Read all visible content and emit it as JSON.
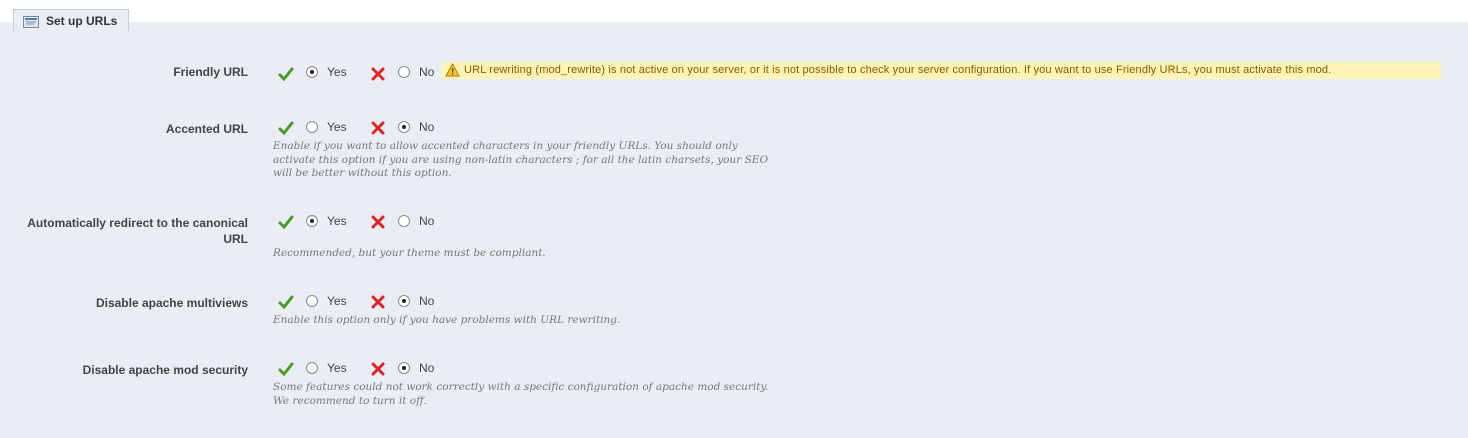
{
  "section": {
    "title": "Set up URLs",
    "icon": "settings-panel-icon"
  },
  "rows": [
    {
      "label": "Friendly URL",
      "yes_label": "Yes",
      "no_label": "No",
      "selected": "yes"
    },
    {
      "label": "Accented URL",
      "yes_label": "Yes",
      "no_label": "No",
      "selected": "no",
      "hint": "Enable if you want to allow accented characters in your friendly URLs. You should only activate this option if you are using non-latin characters ; for all the latin charsets, your SEO will be better without this option."
    },
    {
      "label": "Automatically redirect to the canonical URL",
      "yes_label": "Yes",
      "no_label": "No",
      "selected": "yes",
      "hint": "Recommended, but your theme must be compliant."
    },
    {
      "label": "Disable apache multiviews",
      "yes_label": "Yes",
      "no_label": "No",
      "selected": "no",
      "hint": "Enable this option only if you have problems with URL rewriting."
    },
    {
      "label": "Disable apache mod security",
      "yes_label": "Yes",
      "no_label": "No",
      "selected": "no",
      "hint": "Some features could not work correctly with a specific configuration of apache mod security. We recommend to turn it off."
    }
  ],
  "warning": {
    "icon": "warning-icon",
    "text": "URL rewriting (mod_rewrite) is not active on your server, or it is not possible to check your server configuration. If you want to use Friendly URLs, you must activate this mod."
  },
  "colors": {
    "panel_bg": "#ebedf4",
    "check": "#4a9a2a",
    "cross": "#d9262a",
    "warning_bg": "#fdf3b5"
  }
}
